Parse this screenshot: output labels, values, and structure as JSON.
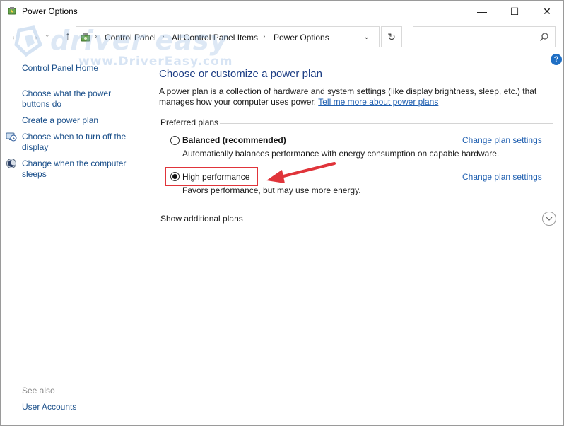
{
  "window": {
    "title": "Power Options",
    "minimize_glyph": "—",
    "maximize_glyph": "☐",
    "close_glyph": "✕"
  },
  "navbar": {
    "back_glyph": "←",
    "forward_glyph": "→",
    "recent_glyph": "⌄",
    "up_glyph": "↑",
    "breadcrumbs": [
      "Control Panel",
      "All Control Panel Items",
      "Power Options"
    ],
    "separator_glyph": "›",
    "dropdown_glyph": "⌄",
    "refresh_glyph": "↻",
    "search_placeholder": ""
  },
  "watermark": {
    "main_text": "driver easy",
    "sub_text": "www.DriverEasy.com"
  },
  "help": {
    "glyph": "?"
  },
  "sidebar": {
    "home_link": "Control Panel Home",
    "links": [
      {
        "label_line1": "Choose what the power",
        "label_line2": "buttons do",
        "icon": ""
      },
      {
        "label_line1": "Create a power plan",
        "label_line2": "",
        "icon": ""
      },
      {
        "label_line1": "Choose when to turn off the",
        "label_line2": "display",
        "icon": "monitor-clock-icon"
      },
      {
        "label_line1": "Change when the computer",
        "label_line2": "sleeps",
        "icon": "moon-sleep-icon"
      }
    ],
    "see_also_label": "See also",
    "see_also_links": [
      "User Accounts"
    ]
  },
  "main": {
    "title": "Choose or customize a power plan",
    "description_line1": "A power plan is a collection of hardware and system settings (like display brightness, sleep, etc.) that",
    "description_line2": "manages how your computer uses power.",
    "description_link": "Tell me more about power plans",
    "preferred_label": "Preferred plans",
    "plans": [
      {
        "name": "Balanced (recommended)",
        "description": "Automatically balances performance with energy consumption on capable hardware.",
        "link": "Change plan settings",
        "selected": false
      },
      {
        "name": "High performance",
        "description": "Favors performance, but may use more energy.",
        "link": "Change plan settings",
        "selected": true
      }
    ],
    "additional_label": "Show additional plans",
    "expand_glyph": "⌄"
  },
  "colors": {
    "link": "#1f5fb0",
    "title": "#1c3d84",
    "annotation_red": "#e0343a"
  }
}
